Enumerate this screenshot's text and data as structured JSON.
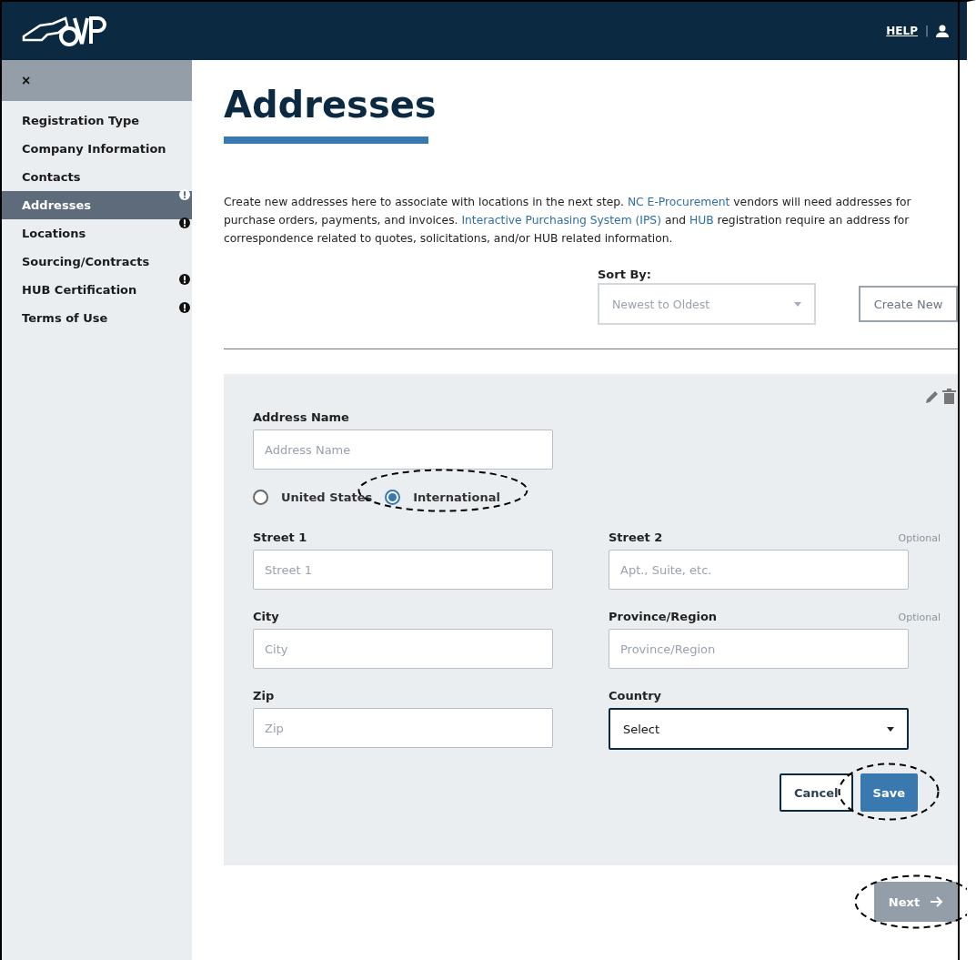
{
  "header": {
    "help": "HELP",
    "separator": "|"
  },
  "sidebar": {
    "close": "×",
    "items": [
      {
        "label": "Registration Type",
        "selected": false,
        "alert": false
      },
      {
        "label": "Company Information",
        "selected": false,
        "alert": false
      },
      {
        "label": "Contacts",
        "selected": false,
        "alert": false
      },
      {
        "label": "Addresses",
        "selected": true,
        "alert": true
      },
      {
        "label": "Locations",
        "selected": false,
        "alert": true
      },
      {
        "label": "Sourcing/Contracts",
        "selected": false,
        "alert": false
      },
      {
        "label": "HUB Certification",
        "selected": false,
        "alert": true
      },
      {
        "label": "Terms of Use",
        "selected": false,
        "alert": true
      }
    ]
  },
  "title": "Addresses",
  "intro": [
    {
      "text": "Create new addresses here to associate with locations in the next step. ",
      "link": false
    },
    {
      "text": "NC E-Procurement",
      "link": true
    },
    {
      "text": " vendors will need addresses for purchase orders, payments, and invoices. ",
      "link": false
    },
    {
      "text": "Interactive Purchasing System (IPS)",
      "link": true
    },
    {
      "text": " and ",
      "link": false
    },
    {
      "text": "HUB",
      "link": true
    },
    {
      "text": " registration require an address for correspondence related to quotes, solicitations, and/or HUB related information.",
      "link": false
    }
  ],
  "sort": {
    "label": "Sort By:",
    "placeholder": "Newest to Oldest"
  },
  "create_button": "Create New",
  "form": {
    "address_name": {
      "label": "Address Name",
      "placeholder": "Address Name"
    },
    "radios": [
      {
        "label": "United States",
        "selected": false,
        "circled": false
      },
      {
        "label": "International",
        "selected": true,
        "circled": true
      }
    ],
    "fields": [
      {
        "kind": "input",
        "label": "Street 1",
        "placeholder": "Street 1"
      },
      {
        "kind": "input",
        "label": "Street 2",
        "placeholder": "Apt., Suite, etc.",
        "note": "Optional"
      },
      {
        "kind": "input",
        "label": "City",
        "placeholder": "City"
      },
      {
        "kind": "input",
        "label": "Province/Region",
        "placeholder": "Province/Region",
        "note": "Optional"
      },
      {
        "kind": "input",
        "label": "Zip",
        "placeholder": "Zip"
      },
      {
        "kind": "select",
        "label": "Country",
        "value": "Select"
      }
    ],
    "buttons": [
      {
        "label": "Cancel",
        "kind": "outline",
        "circled": false
      },
      {
        "label": "Save",
        "kind": "primary",
        "circled": true
      }
    ]
  },
  "next_button": {
    "label": "Next",
    "circled": true
  }
}
